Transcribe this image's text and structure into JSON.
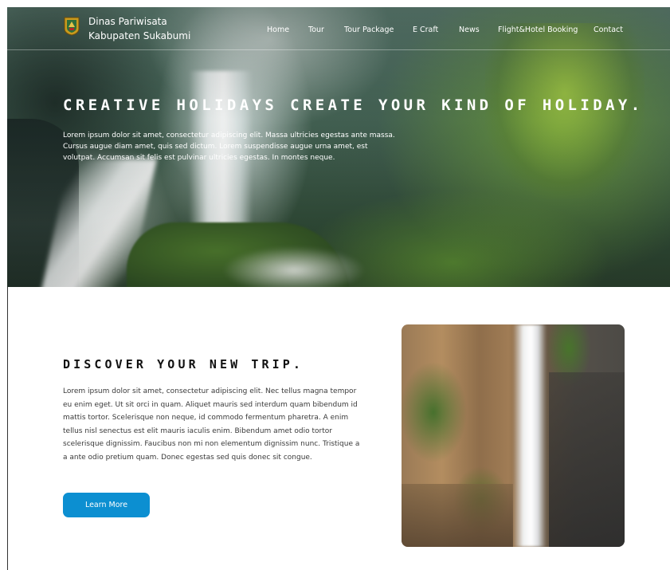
{
  "brand": {
    "line1": "Dinas Pariwisata",
    "line2": "Kabupaten Sukabumi"
  },
  "nav": {
    "items": [
      {
        "label": "Home"
      },
      {
        "label": "Tour"
      },
      {
        "label": "Tour Package"
      },
      {
        "label": "E Craft"
      },
      {
        "label": "News"
      },
      {
        "label": "Flight&Hotel Booking"
      },
      {
        "label": "Contact"
      }
    ]
  },
  "hero": {
    "title": "CREATIVE HOLIDAYS CREATE YOUR KIND OF HOLIDAY.",
    "text": "Lorem ipsum dolor sit amet, consectetur adipiscing elit. Massa ultricies egestas ante massa. Cursus augue diam amet, quis sed dictum. Lorem suspendisse augue urna amet, est volutpat. Accumsan sit felis est pulvinar ultricies egestas. In montes neque."
  },
  "discover": {
    "title": "DISCOVER YOUR NEW TRIP.",
    "text": "Lorem ipsum dolor sit amet, consectetur adipiscing elit. Nec tellus magna tempor eu enim eget. Ut sit orci in quam. Aliquet mauris sed interdum quam bibendum id mattis tortor. Scelerisque non neque, id commodo fermentum pharetra. A enim tellus nisl senectus est elit mauris iaculis enim. Bibendum amet odio tortor scelerisque dignissim. Faucibus non mi non elementum dignissim nunc. Tristique a a ante odio pretium quam. Donec egestas sed quis donec sit congue.",
    "button_label": "Learn More"
  },
  "colors": {
    "accent": "#0c8fd1",
    "heading": "#111111",
    "hero_text": "#ffffff"
  },
  "icons": {
    "brand_logo": "regency-crest-icon"
  }
}
